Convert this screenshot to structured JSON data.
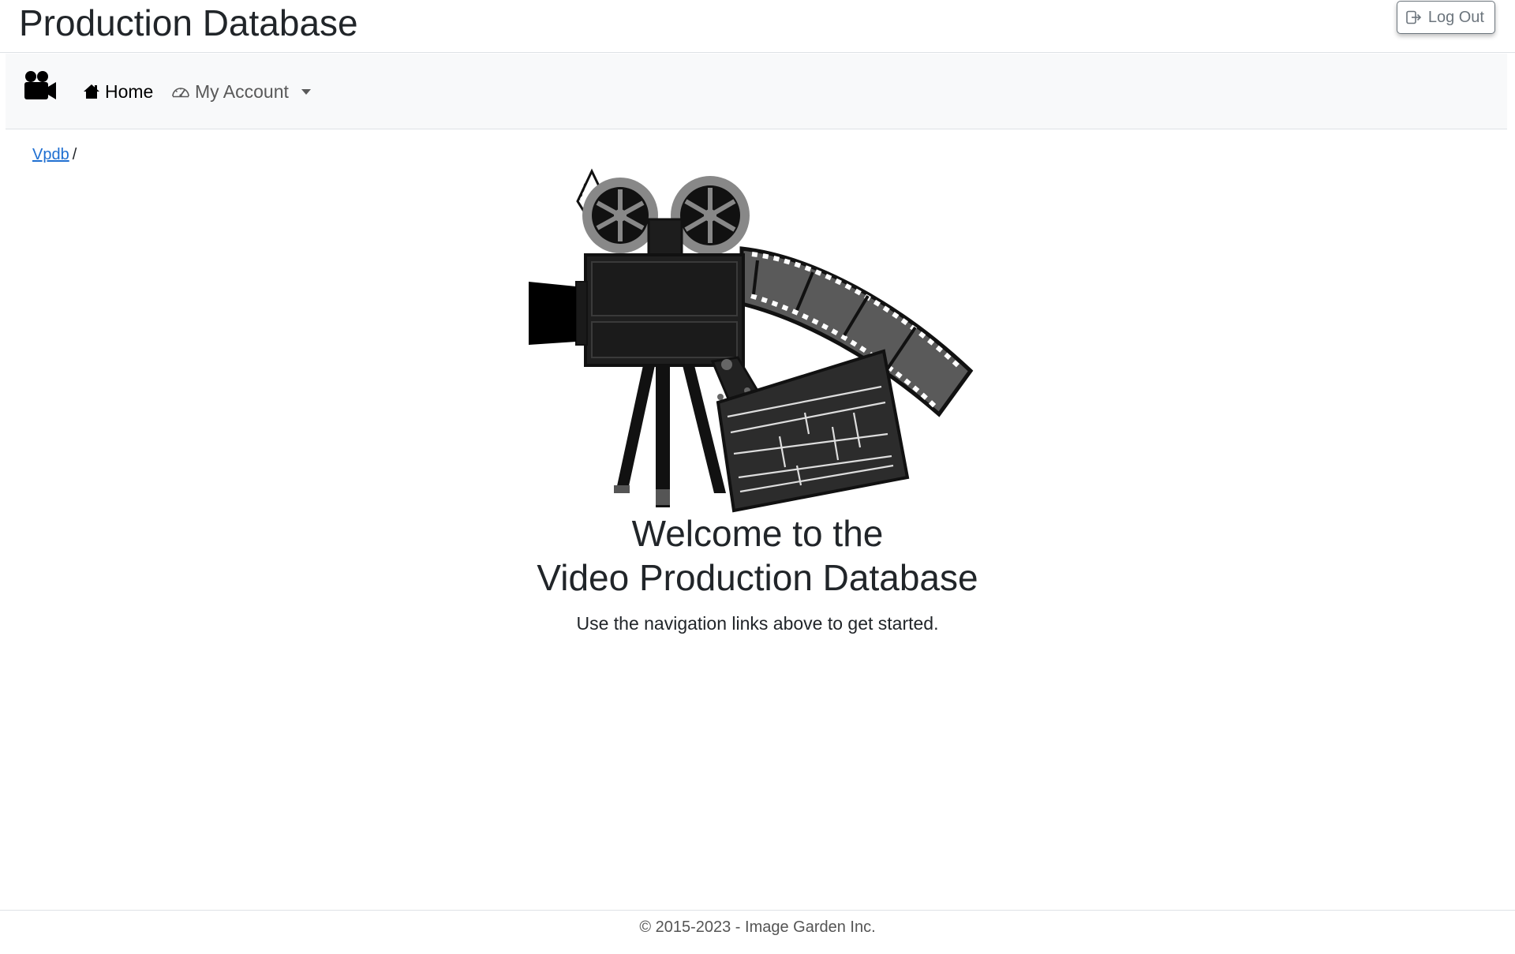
{
  "header": {
    "title": "Production Database",
    "logout_label": "Log Out"
  },
  "navbar": {
    "brand_icon": "video-camera-icon",
    "home_label": "Home",
    "account_label": "My Account"
  },
  "breadcrumb": {
    "root_label": "Vpdb",
    "separator": "/"
  },
  "main": {
    "welcome_line1": "Welcome to the",
    "welcome_line2": "Video Production Database",
    "lead": "Use the navigation links above to get started."
  },
  "footer": {
    "copyright": "© 2015-2023 - Image Garden Inc."
  },
  "colors": {
    "link": "#1f6fd1",
    "navbar_bg": "#f8f9fa",
    "text": "#212529",
    "muted": "#6c757d"
  }
}
